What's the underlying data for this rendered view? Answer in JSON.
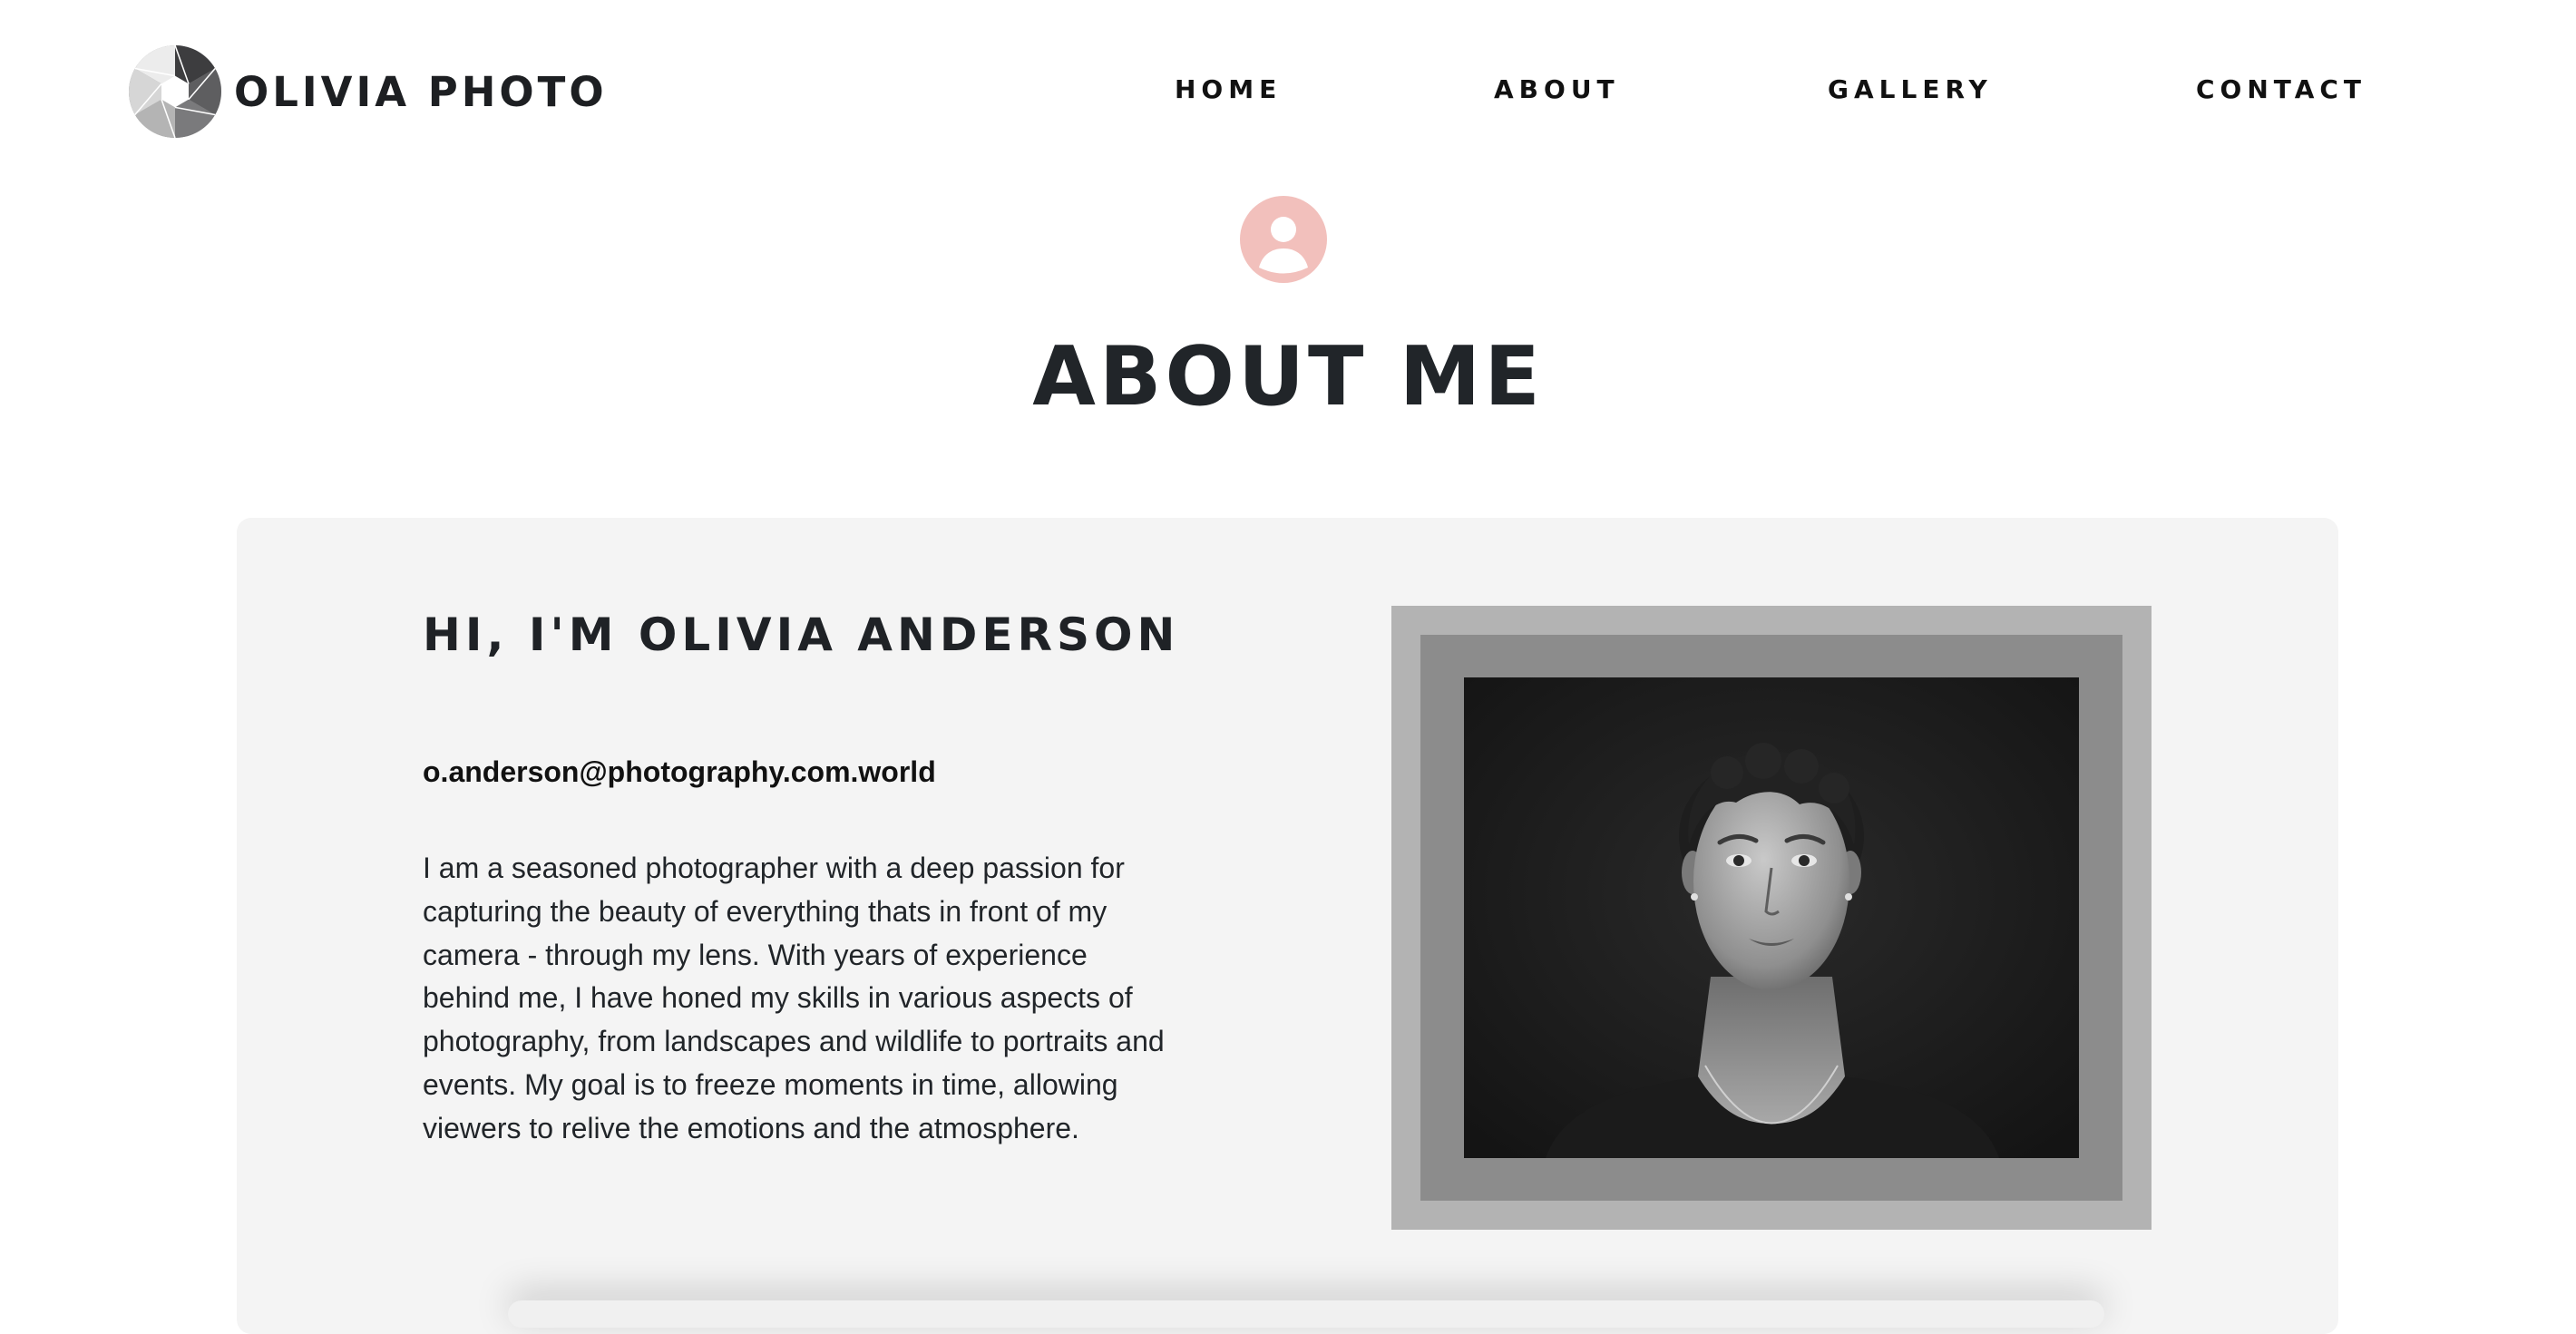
{
  "brand": {
    "name": "OLIVIA PHOTO"
  },
  "nav": {
    "home": "HOME",
    "about": "ABOUT",
    "gallery": "GALLERY",
    "contact": "CONTACT"
  },
  "hero": {
    "icon": "user-avatar-icon",
    "icon_color": "#f2c0bc",
    "title": "ABOUT ME"
  },
  "about": {
    "greeting": "HI, I'M OLIVIA ANDERSON",
    "email": "o.anderson@photography.com.world",
    "bio": "I am a seasoned photographer with a deep passion for capturing the beauty of everything thats in front of my camera - through my lens. With years of experience behind me, I have honed my skills in various aspects of photography, from landscapes and wildlife to portraits and events. My goal is to freeze moments in time, allowing viewers to relive the emotions and the atmosphere."
  },
  "colors": {
    "card_background": "#f4f4f4",
    "frame_outer": "#b3b3b3",
    "frame_inner": "#8c8c8c",
    "text_dark": "#212529"
  }
}
